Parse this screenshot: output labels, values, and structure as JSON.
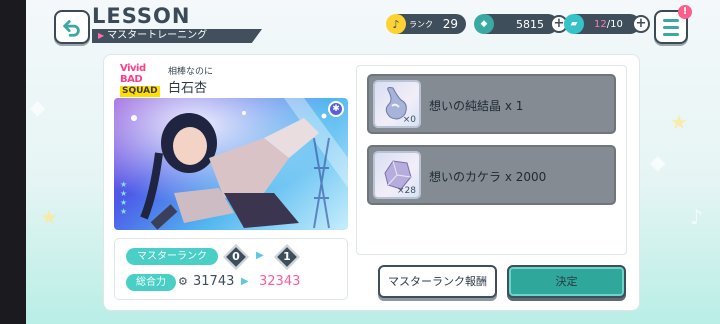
{
  "header": {
    "title": "LESSON",
    "subtitle": "マスタートレーニング"
  },
  "resources": {
    "rank_label": "ランク",
    "rank_value": "29",
    "gem_value": "5815",
    "ticket_current": "12",
    "ticket_max": "/10"
  },
  "menu": {
    "badge": "!"
  },
  "card": {
    "unit_logo_line1": "Vivid BAD",
    "unit_logo_line2": "SQUAD",
    "subtitle": "相棒なのに",
    "character_name": "白石杏",
    "attribute_icon": "star-badge-icon"
  },
  "stats": {
    "master_rank_label": "マスターランク",
    "rank_from": "0",
    "rank_to": "1",
    "power_label": "総合力",
    "power_from": "31743",
    "power_to": "32343"
  },
  "items": [
    {
      "name": "想いの純結晶 x 1",
      "owned": "×0",
      "icon": "crystal-drop-icon"
    },
    {
      "name": "想いのカケラ x 2000",
      "owned": "×28",
      "icon": "crystal-shard-icon"
    }
  ],
  "buttons": {
    "reward_label": "マスターランク報酬",
    "confirm_label": "決定"
  },
  "colors": {
    "accent_teal": "#49cfc6",
    "dark_slate": "#3f4e5b",
    "pink": "#ff5c9e"
  }
}
